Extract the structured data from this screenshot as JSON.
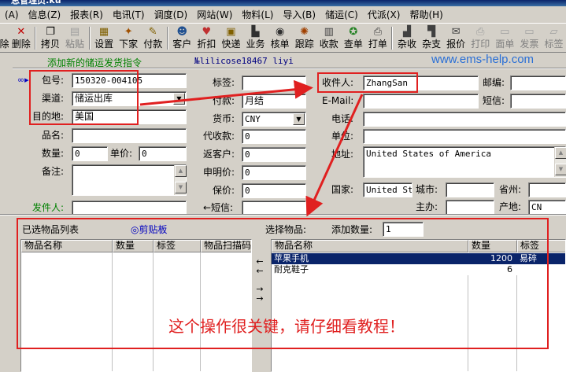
{
  "window": {
    "title": "总管理员:ku"
  },
  "menu": [
    {
      "label": "(A)"
    },
    {
      "label": "信息(Z)"
    },
    {
      "label": "报表(R)"
    },
    {
      "label": "电讯(T)"
    },
    {
      "label": "调度(D)"
    },
    {
      "label": "网站(W)"
    },
    {
      "label": "物料(L)"
    },
    {
      "label": "导入(B)"
    },
    {
      "label": "储运(C)"
    },
    {
      "label": "代派(X)"
    },
    {
      "label": "帮助(H)"
    }
  ],
  "toolbar": [
    {
      "label": "除",
      "icon": "delete-icon",
      "enabled": true
    },
    {
      "label": "删除",
      "icon": "delete-icon",
      "enabled": true
    },
    {
      "label": "拷贝",
      "icon": "copy-icon",
      "enabled": true
    },
    {
      "label": "粘贴",
      "icon": "paste-icon",
      "enabled": false
    },
    {
      "label": "设置",
      "icon": "settings-icon",
      "enabled": true
    },
    {
      "label": "下家",
      "icon": "downstream-icon",
      "enabled": true
    },
    {
      "label": "付款",
      "icon": "payment-icon",
      "enabled": true
    },
    {
      "label": "客户",
      "icon": "customer-icon",
      "enabled": true
    },
    {
      "label": "折扣",
      "icon": "discount-icon",
      "enabled": true
    },
    {
      "label": "快递",
      "icon": "express-icon",
      "enabled": true
    },
    {
      "label": "业务",
      "icon": "business-icon",
      "enabled": true
    },
    {
      "label": "核单",
      "icon": "verify-icon",
      "enabled": true
    },
    {
      "label": "跟踪",
      "icon": "track-icon",
      "enabled": true
    },
    {
      "label": "收款",
      "icon": "receive-icon",
      "enabled": true
    },
    {
      "label": "查单",
      "icon": "query-icon",
      "enabled": true
    },
    {
      "label": "打单",
      "icon": "print-order-icon",
      "enabled": true
    },
    {
      "label": "杂收",
      "icon": "misc-income-icon",
      "enabled": true
    },
    {
      "label": "杂支",
      "icon": "misc-expense-icon",
      "enabled": true
    },
    {
      "label": "报价",
      "icon": "quote-icon",
      "enabled": true
    },
    {
      "label": "打印",
      "icon": "print-icon",
      "enabled": false
    },
    {
      "label": "面单",
      "icon": "waybill-icon",
      "enabled": false
    },
    {
      "label": "发票",
      "icon": "invoice-icon",
      "enabled": false
    },
    {
      "label": "标签",
      "icon": "tag-icon",
      "enabled": false
    }
  ],
  "header": {
    "instruction": "添加新的储运发货指令",
    "user": "№lilicose18467 liyi",
    "watermark": "www.ems-help.com"
  },
  "form": {
    "package_no_label": "包号:",
    "package_no": "150320-004105",
    "channel_label": "渠道:",
    "channel": "储运出库",
    "destination_label": "目的地:",
    "destination": "美国",
    "item_name_label": "品名:",
    "item_name": "",
    "quantity_label": "数量:",
    "quantity": "0",
    "unit_price_label": "单价:",
    "unit_price": "0",
    "remark_label": "备注:",
    "remark": "",
    "sender_label": "发件人:",
    "sender": "",
    "tag_label": "标签:",
    "tag": "",
    "payment_label": "付款:",
    "payment": "月结",
    "currency_label": "货币:",
    "currency": "CNY",
    "cod_label": "代收款:",
    "cod": "0",
    "return_label": "返客户:",
    "return": "0",
    "declared_label": "申明价:",
    "declared": "0",
    "insured_label": "保价:",
    "insured": "0",
    "sms_label": "←短信:",
    "sms": "",
    "recipient_label": "收件人:",
    "recipient": "ZhangSan",
    "zip_label": "邮编:",
    "zip": "",
    "email_label": "E-Mail:",
    "email": "",
    "sms2_label": "短信:",
    "sms2": "",
    "phone_label": "电话:",
    "phone": "",
    "company_label": "单位:",
    "company": "",
    "address_label": "地址:",
    "address": "United States of America",
    "country_label": "国家:",
    "country": "United Sta",
    "city_label": "城市:",
    "city": "",
    "province_label": "省州:",
    "province": "",
    "owner_label": "主办:",
    "owner": "",
    "origin_label": "产地:",
    "origin": "CN"
  },
  "lower": {
    "selected_label": "已选物品列表",
    "clipboard_label": "◎剪贴板",
    "choose_label": "选择物品:",
    "add_qty_label": "添加数量:",
    "add_qty": "1",
    "left_columns": [
      "物品名称",
      "数量",
      "标签",
      "物品扫描码"
    ],
    "right_columns": [
      "物品名称",
      "数量",
      "标签"
    ],
    "items": [
      {
        "name": "苹果手机",
        "qty": "1200",
        "tag": "易碎",
        "selected": true
      },
      {
        "name": "耐克鞋子",
        "qty": "6",
        "tag": "",
        "selected": false
      }
    ],
    "move_buttons": [
      "←",
      "←",
      "→",
      "→"
    ],
    "notice": "这个操作很关键，请仔细看教程！"
  },
  "colors": {
    "annotation": "#e02020",
    "selection": "#0a246a",
    "watermark": "#2a6fd6",
    "green_label": "#008000"
  }
}
